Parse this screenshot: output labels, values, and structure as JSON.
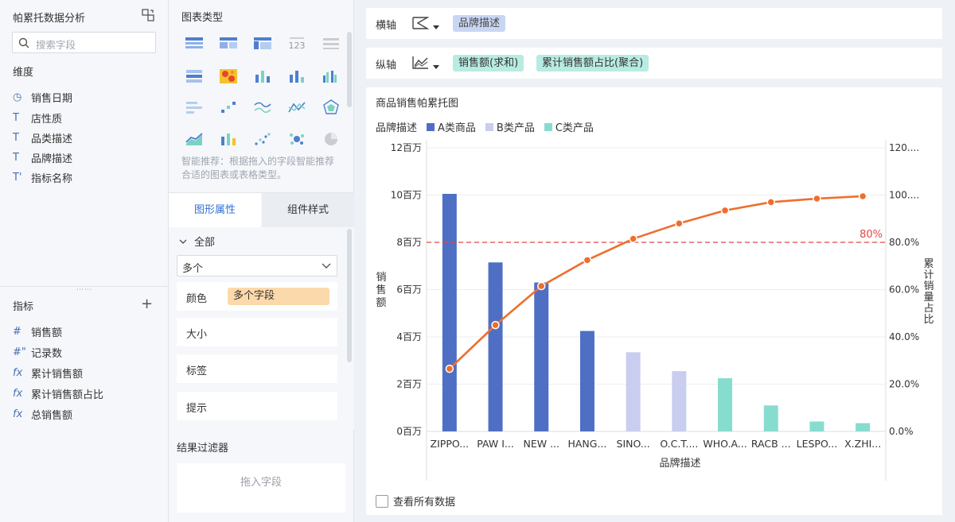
{
  "fields_panel": {
    "title": "帕累托数据分析",
    "search_placeholder": "搜索字段",
    "dimension_label": "维度",
    "dimensions": [
      {
        "icon": "clock-icon",
        "glyph": "◷",
        "label": "销售日期"
      },
      {
        "icon": "text-icon",
        "glyph": "T",
        "label": "店性质"
      },
      {
        "icon": "text-icon",
        "glyph": "T",
        "label": "品类描述"
      },
      {
        "icon": "text-icon",
        "glyph": "T",
        "label": "品牌描述"
      },
      {
        "icon": "text-derived-icon",
        "glyph": "T'",
        "label": "指标名称"
      }
    ],
    "metric_label": "指标",
    "metrics": [
      {
        "icon": "hash-icon",
        "glyph": "#",
        "label": "销售额"
      },
      {
        "icon": "hash-derived-icon",
        "glyph": "#\"",
        "label": "记录数"
      },
      {
        "icon": "formula-icon",
        "glyph": "fx",
        "label": "累计销售额"
      },
      {
        "icon": "formula-icon",
        "glyph": "fx",
        "label": "累计销售额占比"
      },
      {
        "icon": "formula-icon",
        "glyph": "fx",
        "label": "总销售额"
      }
    ]
  },
  "config_panel": {
    "chart_type_title": "图表类型",
    "smart_hint": "智能推荐：根据拖入的字段智能推荐合适的图表或表格类型。",
    "tab_graphic": "图形属性",
    "tab_component": "组件样式",
    "all_label": "全部",
    "multi_select": "多个",
    "color_label": "颜色",
    "color_value": "多个字段",
    "size_label": "大小",
    "label_label": "标签",
    "tooltip_label": "提示",
    "filter_title": "结果过滤器",
    "drop_hint": "拖入字段"
  },
  "axes": {
    "x_label": "横轴",
    "x_field": "品牌描述",
    "y_label": "纵轴",
    "y_field1": "销售额(求和)",
    "y_field2": "累计销售额占比(聚合)"
  },
  "chart": {
    "title": "商品销售帕累托图",
    "show_all": "查看所有数据"
  },
  "colors": {
    "a": "#4e6fc3",
    "b": "#c9cdef",
    "c": "#87dcd0",
    "line": "#ef6e2c",
    "ref": "#e24848"
  },
  "chart_data": {
    "type": "bar",
    "title": "商品销售帕累托图",
    "legend_title": "品牌描述",
    "categories": [
      "ZIPPO...",
      "PAW I...",
      "NEW ...",
      "HANG...",
      "SINO...",
      "O.C.T....",
      "WHO.A...",
      "RACB ...",
      "LESPO...",
      "X.ZHI..."
    ],
    "series": [
      {
        "name": "A类商品",
        "type": "bar",
        "values": [
          10050000,
          7150000,
          6300000,
          4250000,
          null,
          null,
          null,
          null,
          null,
          null
        ]
      },
      {
        "name": "B类产品",
        "type": "bar",
        "values": [
          null,
          null,
          null,
          null,
          3350000,
          2550000,
          null,
          null,
          null,
          null
        ]
      },
      {
        "name": "C类产品",
        "type": "bar",
        "values": [
          null,
          null,
          null,
          null,
          null,
          null,
          2250000,
          1100000,
          420000,
          350000
        ]
      },
      {
        "type": "line",
        "axis": "right",
        "values": [
          26.5,
          45,
          61.5,
          72.5,
          81.5,
          88,
          93.5,
          97,
          98.5,
          99.5
        ]
      }
    ],
    "xlabel": "品牌描述",
    "ylabel": "销售额",
    "ylabel_right": "累计销量占比",
    "y_ticks": [
      "0百万",
      "2百万",
      "4百万",
      "6百万",
      "8百万",
      "10百万",
      "12百万"
    ],
    "y2_ticks": [
      "0.0%",
      "20.0%",
      "40.0%",
      "60.0%",
      "80.0%",
      "100....",
      "120...."
    ],
    "ylim": [
      0,
      12000000
    ],
    "y2lim": [
      0,
      120
    ],
    "reference_line": {
      "value": 80,
      "label": "80%"
    },
    "grid": true,
    "legend_position": "top-left"
  }
}
